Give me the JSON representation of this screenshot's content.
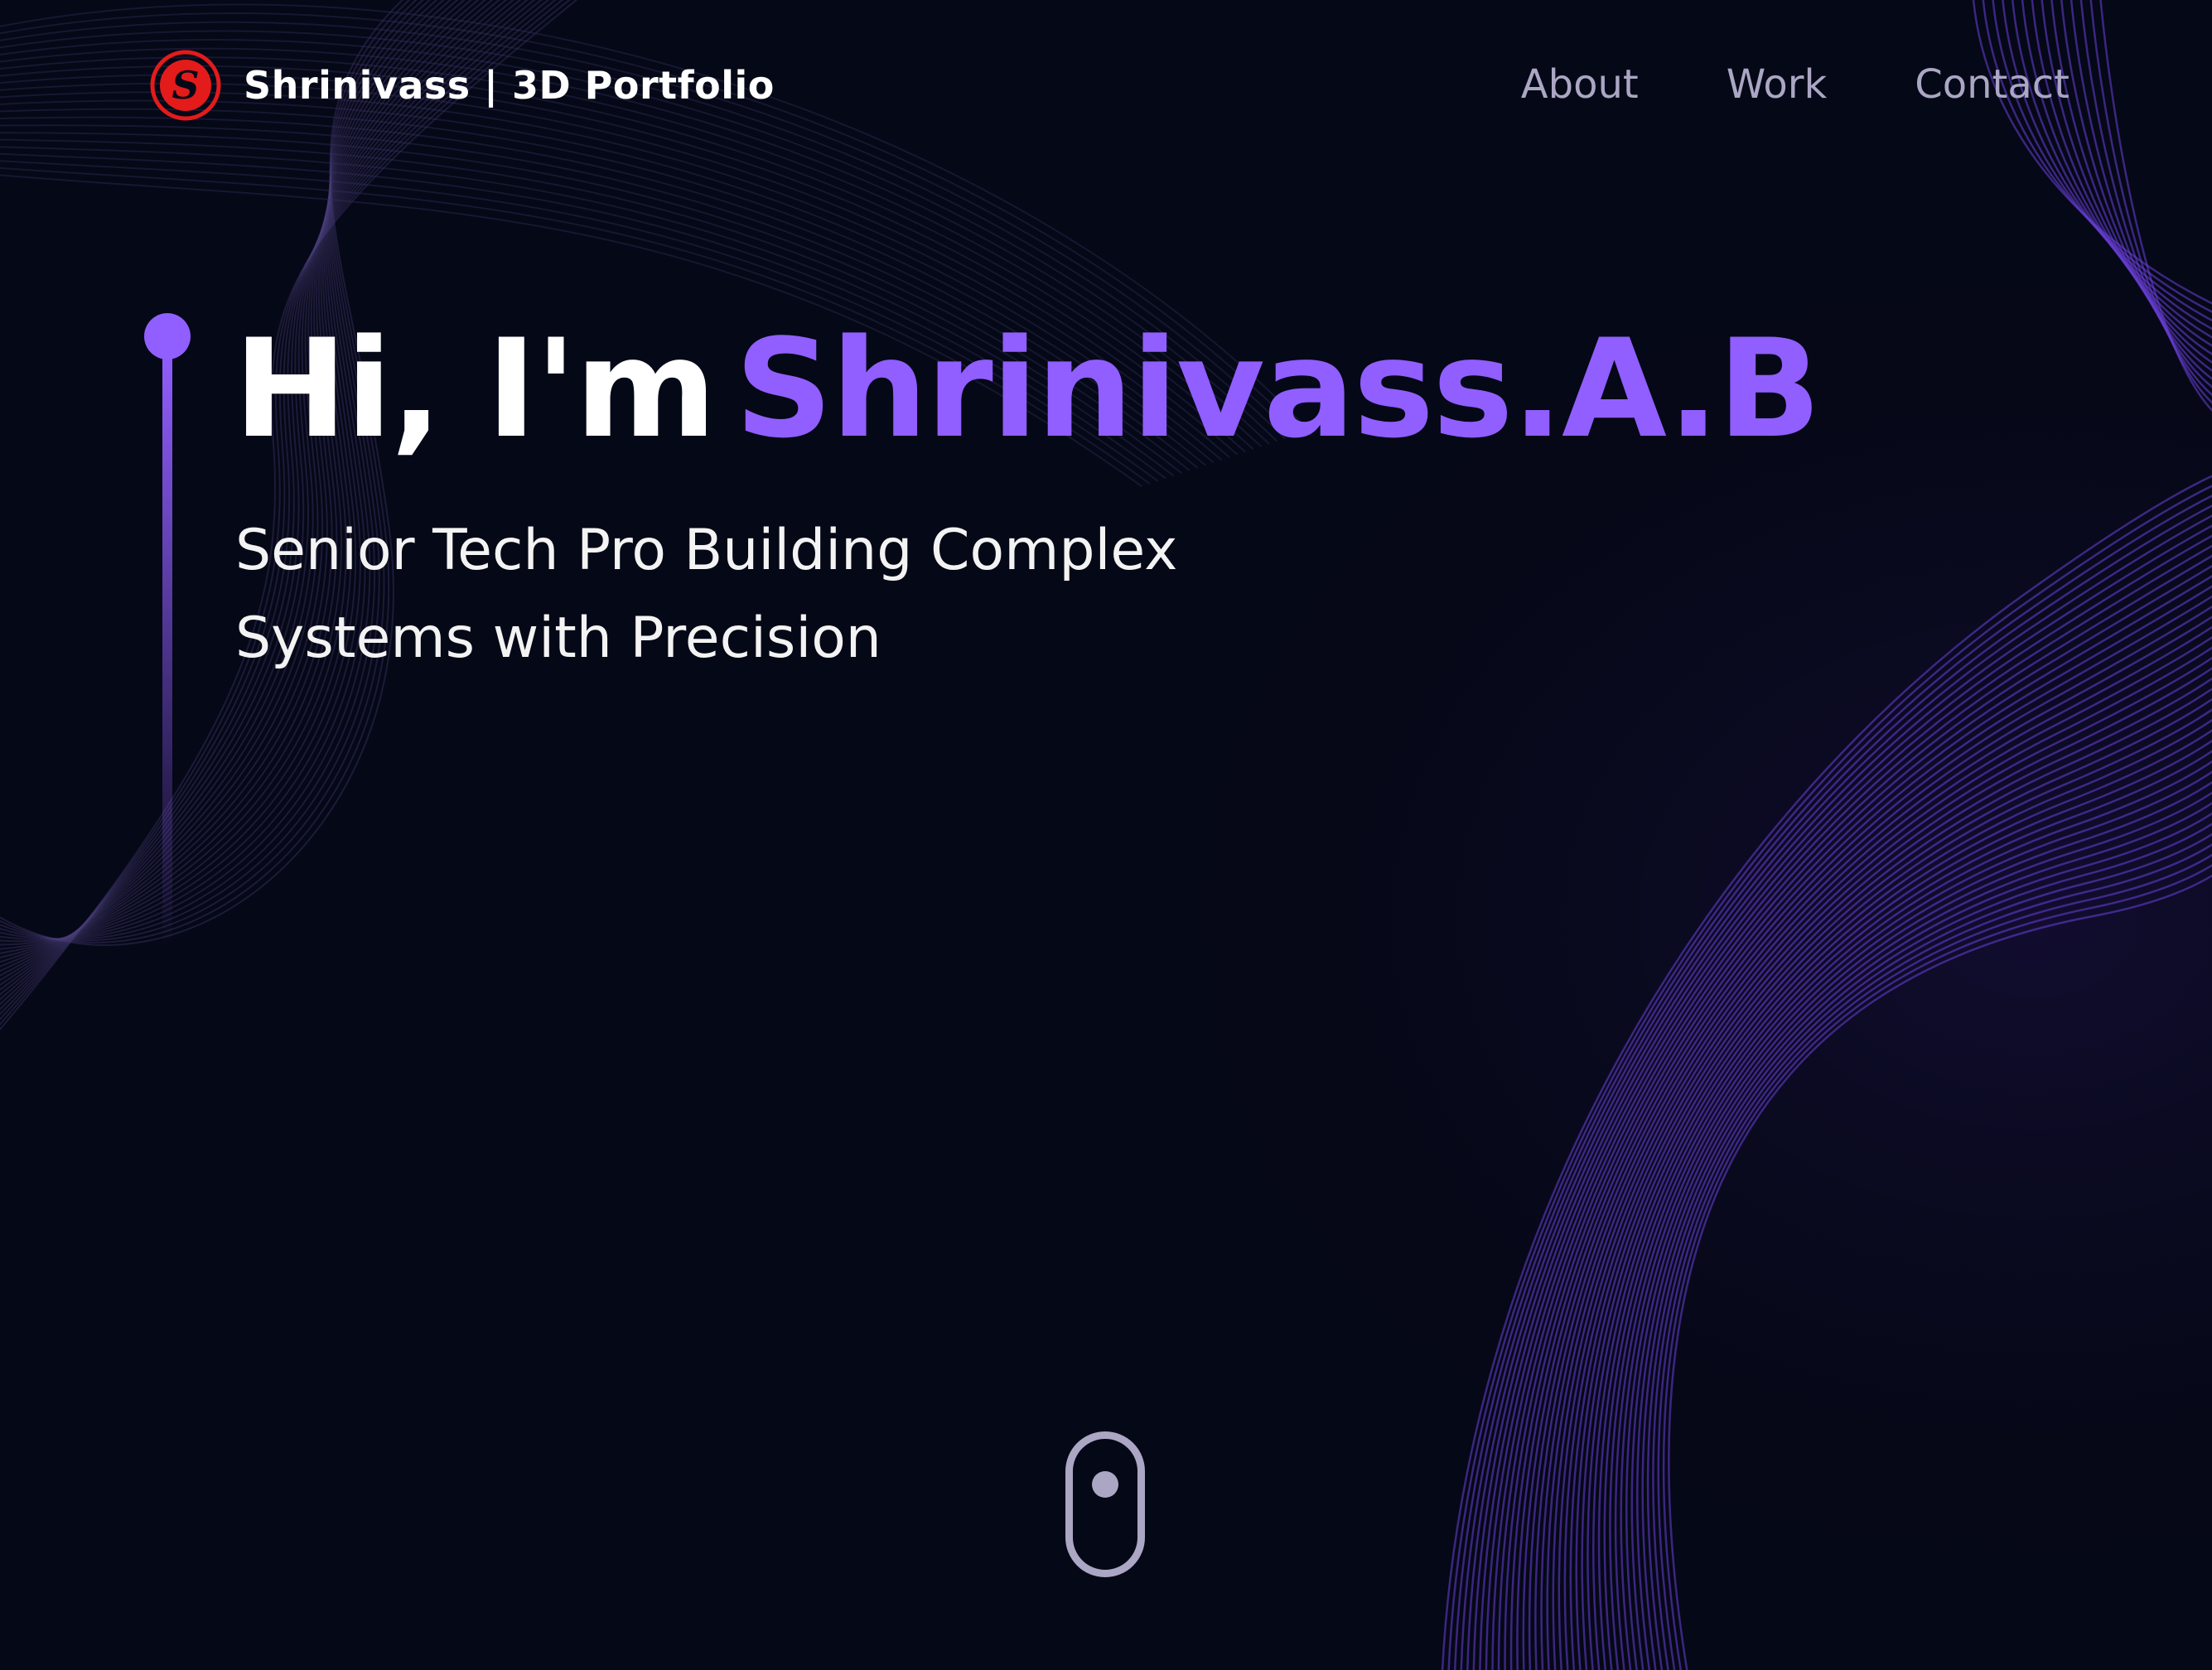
{
  "colors": {
    "background": "#050816",
    "accent": "#915eff",
    "nav_text": "#aaa6c3",
    "heading_text": "#ffffff",
    "logo_red": "#e31b1b"
  },
  "navbar": {
    "logo_icon": "s-logo-icon",
    "logo_letter": "S",
    "brand_text": "Shrinivass | 3D Portfolio",
    "links": [
      {
        "label": "About"
      },
      {
        "label": "Work"
      },
      {
        "label": "Contact"
      }
    ]
  },
  "hero": {
    "greeting": "Hi, I'm",
    "name": "Shrinivass.A.B",
    "subtitle_line1": "Senior Tech Pro Building Complex",
    "subtitle_line2": "Systems with Precision"
  },
  "scroll_indicator": {
    "icon": "mouse-scroll-icon"
  }
}
